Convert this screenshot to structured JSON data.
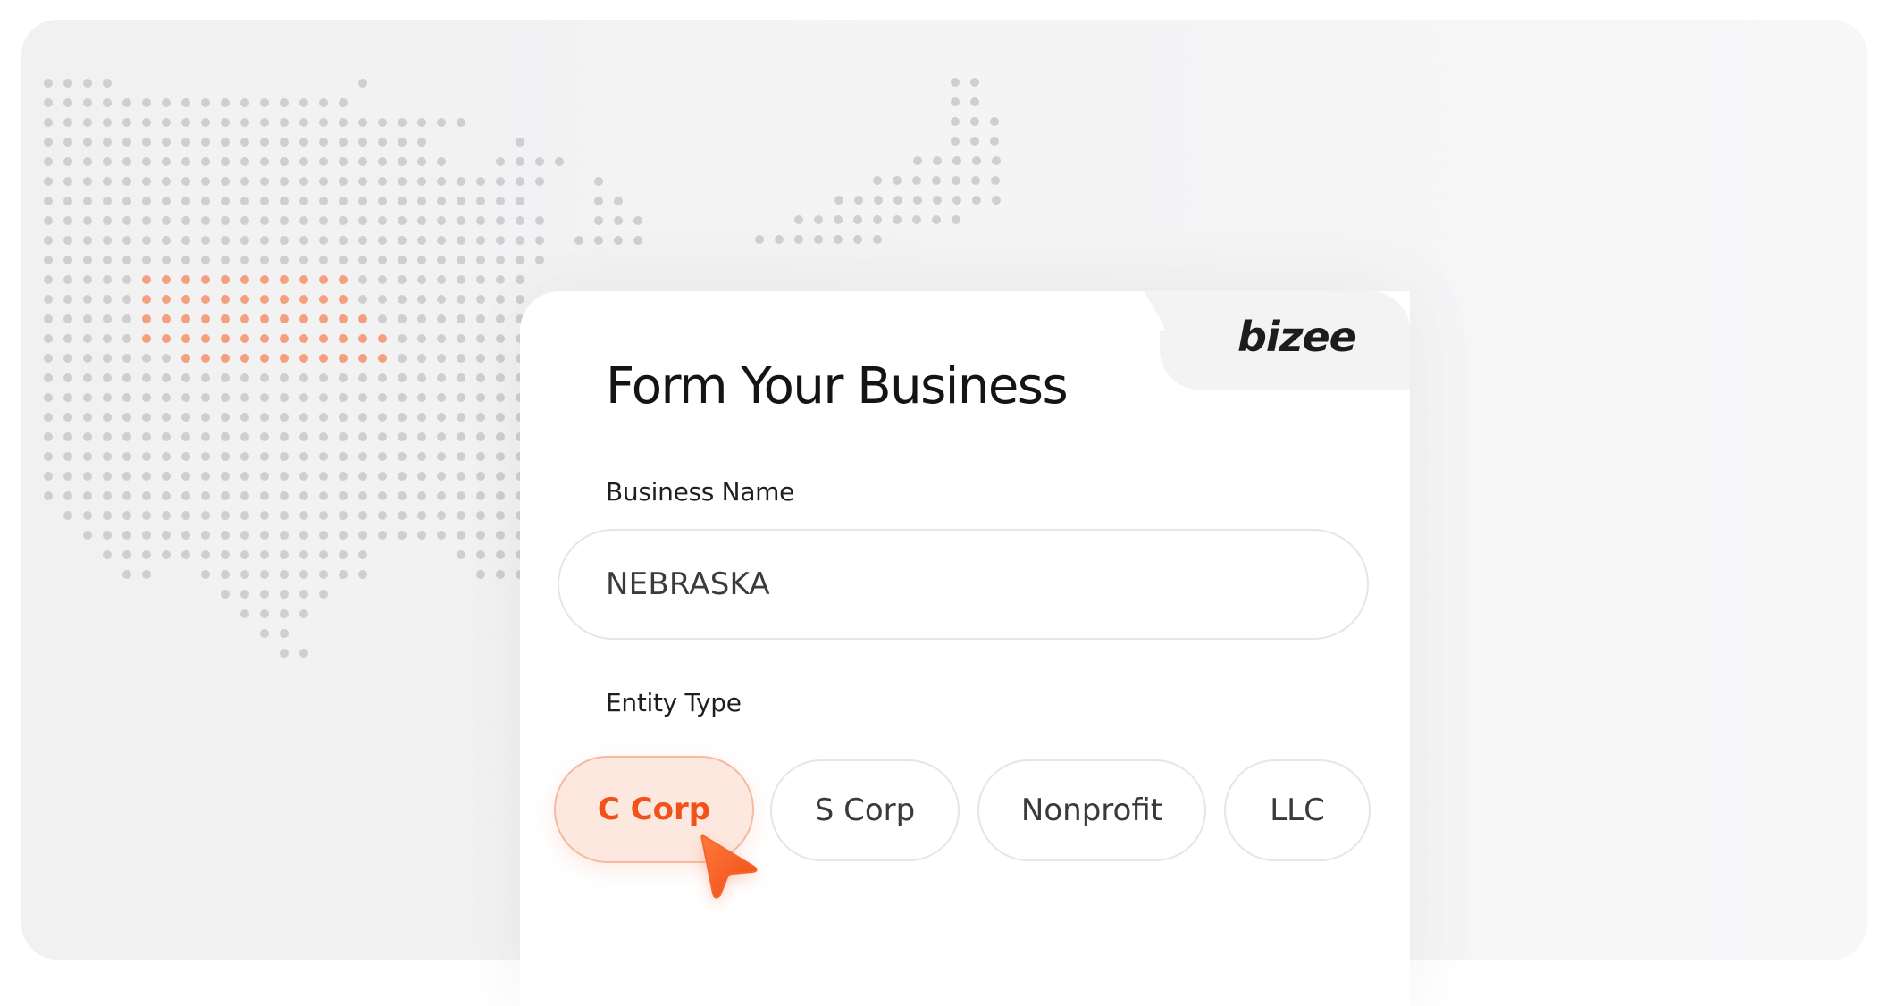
{
  "brand": {
    "logo_text": "bizee",
    "accent_color": "#f1511a",
    "map_highlight_color": "#f4a07e",
    "map_dot_color": "#cfcfd2"
  },
  "form": {
    "title": "Form Your Business",
    "business_name": {
      "label": "Business Name",
      "value": "NEBRASKA"
    },
    "entity_type": {
      "label": "Entity Type",
      "selected": "C Corp",
      "options": [
        "C Corp",
        "S Corp",
        "Nonprofit",
        "LLC"
      ]
    }
  },
  "icons": {
    "cursor": "cursor-arrow-icon",
    "map": "us-dot-map"
  }
}
